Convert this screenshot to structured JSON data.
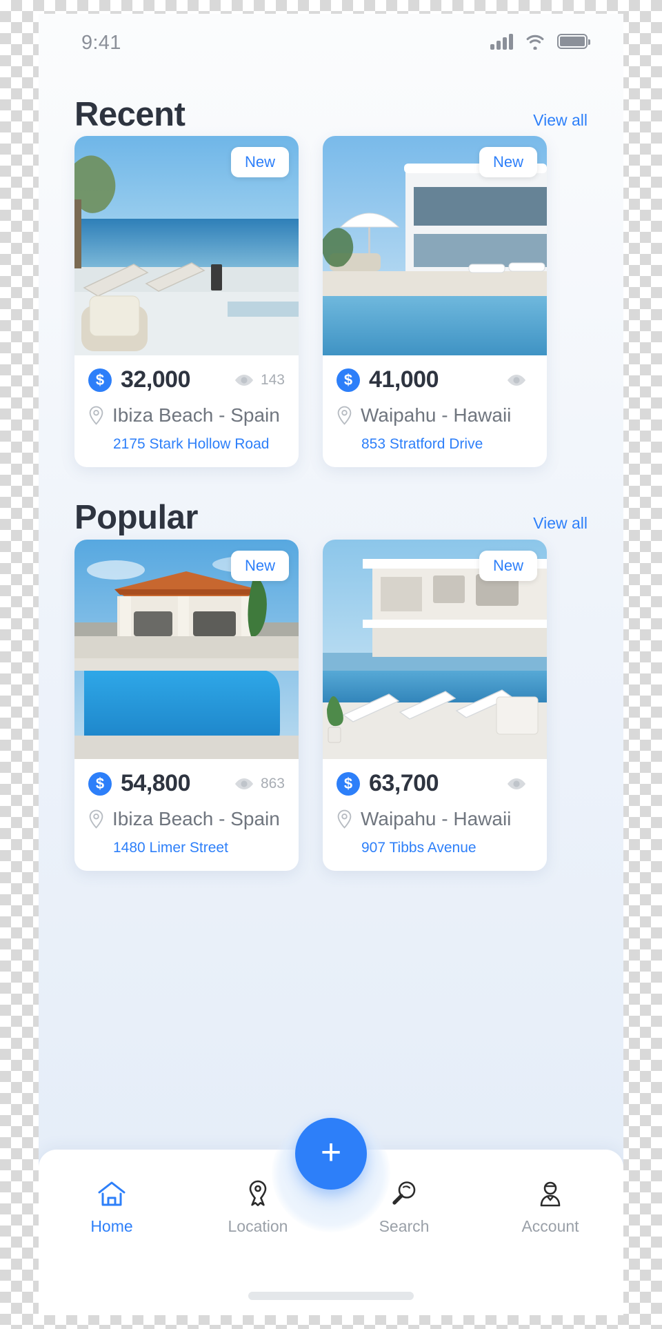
{
  "status_bar": {
    "time": "9:41",
    "signal_icon": "signal-bars-icon",
    "wifi_icon": "wifi-icon",
    "battery_icon": "battery-icon"
  },
  "sections": [
    {
      "title": "Recent",
      "view_all_label": "View all",
      "cards": [
        {
          "badge": "New",
          "price": "32,000",
          "currency_icon": "dollar-icon",
          "views": "143",
          "views_icon": "eye-icon",
          "location": "Ibiza Beach - Spain",
          "location_icon": "map-pin-icon",
          "address": "2175 Stark Hollow Road",
          "photo": "beach-loungers-ocean-view"
        },
        {
          "badge": "New",
          "price": "41,000",
          "currency_icon": "dollar-icon",
          "views": "",
          "views_icon": "eye-icon",
          "location": "Waipahu - Hawaii",
          "location_icon": "map-pin-icon",
          "address": "853 Stratford Drive",
          "photo": "modern-villa-pool-umbrella"
        }
      ]
    },
    {
      "title": "Popular",
      "view_all_label": "View all",
      "cards": [
        {
          "badge": "New",
          "price": "54,800",
          "currency_icon": "dollar-icon",
          "views": "863",
          "views_icon": "eye-icon",
          "location": "Ibiza Beach - Spain",
          "location_icon": "map-pin-icon",
          "address": "1480 Limer Street",
          "photo": "villa-pergola-blue-pool"
        },
        {
          "badge": "New",
          "price": "63,700",
          "currency_icon": "dollar-icon",
          "views": "",
          "views_icon": "eye-icon",
          "location": "Waipahu - Hawaii",
          "location_icon": "map-pin-icon",
          "address": "907 Tibbs Avenue",
          "photo": "white-house-infinity-pool-loungers"
        }
      ]
    }
  ],
  "bottom_nav": {
    "items": [
      {
        "label": "Home",
        "icon": "home-icon",
        "active": true
      },
      {
        "label": "Location",
        "icon": "location-pin-icon",
        "active": false
      },
      {
        "label": "Search",
        "icon": "magnifier-icon",
        "active": false
      },
      {
        "label": "Account",
        "icon": "person-icon",
        "active": false
      }
    ],
    "fab_label": "+",
    "fab_icon": "plus-icon"
  },
  "colors": {
    "accent": "#2d7ff9",
    "title": "#2e3440",
    "muted": "#9aa0a8",
    "card_bg": "#ffffff"
  }
}
